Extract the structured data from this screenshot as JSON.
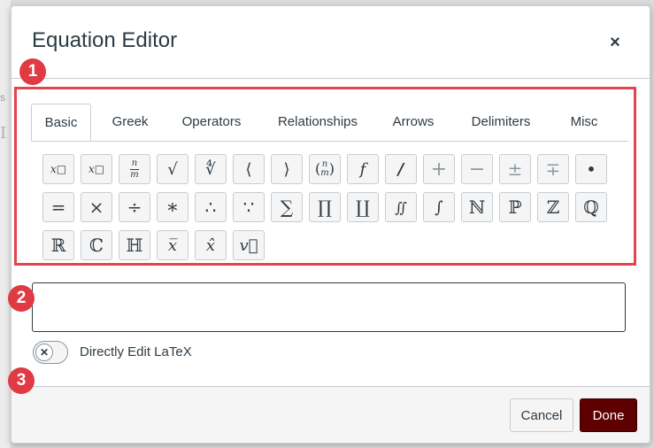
{
  "background": {
    "fragment_s": "s",
    "fragment_i": "I"
  },
  "dialog": {
    "title": "Equation Editor",
    "close_glyph": "×"
  },
  "tabs": [
    {
      "label": "Basic",
      "active": true
    },
    {
      "label": "Greek"
    },
    {
      "label": "Operators"
    },
    {
      "label": "Relationships"
    },
    {
      "label": "Arrows"
    },
    {
      "label": "Delimiters"
    },
    {
      "label": "Misc"
    }
  ],
  "symbols": {
    "subscript": "x□",
    "superscript": "x□",
    "fraction_num": "n",
    "fraction_den": "m",
    "sqrt": "√",
    "nth_root": "∜",
    "langle": "⟨",
    "rangle": "⟩",
    "binom_num": "n",
    "binom_den": "m",
    "function": "f",
    "bold": "/",
    "plus": "+",
    "minus": "−",
    "plus_minus": "±",
    "minus_plus": "∓",
    "bullet": "•",
    "equals": "=",
    "times": "×",
    "divide": "÷",
    "ast": "∗",
    "therefore": "∴",
    "because": "∵",
    "sum": "∑",
    "prod": "∏",
    "coprod": "∐",
    "iint": "∬",
    "int": "∫",
    "naturals": "ℕ",
    "primes": "ℙ",
    "integers": "ℤ",
    "rationals": "ℚ",
    "reals": "ℝ",
    "complex": "ℂ",
    "quaternions": "ℍ",
    "overline": "x̅",
    "hat": "x̂",
    "vec": "v⃗"
  },
  "equation_input": {
    "value": ""
  },
  "toggle": {
    "label": "Directly Edit LaTeX",
    "state": "off",
    "knob_glyph": "✕"
  },
  "footer": {
    "cancel_label": "Cancel",
    "done_label": "Done"
  },
  "callouts": [
    "1",
    "2",
    "3"
  ],
  "colors": {
    "callout": "#e03a43",
    "done_button": "#5e0000",
    "text": "#2d3b45"
  }
}
